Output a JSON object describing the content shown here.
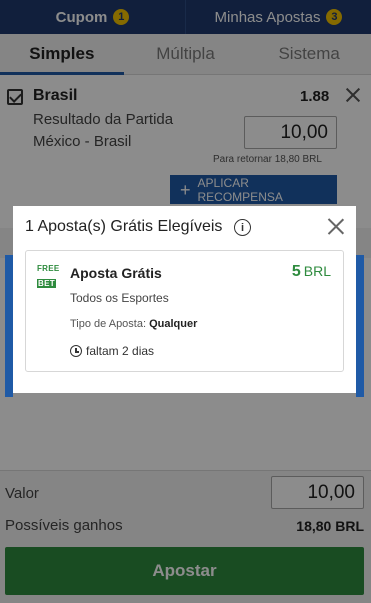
{
  "top_tabs": [
    {
      "label": "Cupom",
      "badge": "1",
      "active": true
    },
    {
      "label": "Minhas Apostas",
      "badge": "3",
      "active": false
    }
  ],
  "sub_tabs": [
    {
      "label": "Simples",
      "active": true
    },
    {
      "label": "Múltipla",
      "active": false
    },
    {
      "label": "Sistema",
      "active": false
    }
  ],
  "bet": {
    "team": "Brasil",
    "odds": "1.88",
    "market": "Resultado da Partida",
    "event": "México - Brasil",
    "stake": "10,00",
    "return_text": "Para retornar 18,80 BRL",
    "reward_button": "APLICAR RECOMPENSA",
    "reward_plus": "+"
  },
  "modal": {
    "title": "1 Aposta(s) Grátis Elegíveis",
    "info_glyph": "i",
    "card": {
      "badge_top": "FREE",
      "badge_bottom": "BET",
      "title": "Aposta Grátis",
      "amount": "5",
      "currency": "BRL",
      "sports": "Todos os Esportes",
      "type_label": "Tipo de Aposta:",
      "type_value": "Qualquer",
      "expiry": "faltam 2 dias"
    }
  },
  "summary": {
    "valor_label": "Valor",
    "valor_value": "10,00",
    "ganhos_label": "Possíveis ganhos",
    "ganhos_value": "18,80 BRL",
    "apostar_label": "Apostar"
  },
  "colors": {
    "header_bg": "#1f3a6e",
    "accent_blue": "#1f5aa6",
    "badge_yellow": "#f2c200",
    "green": "#2e8b3e"
  }
}
